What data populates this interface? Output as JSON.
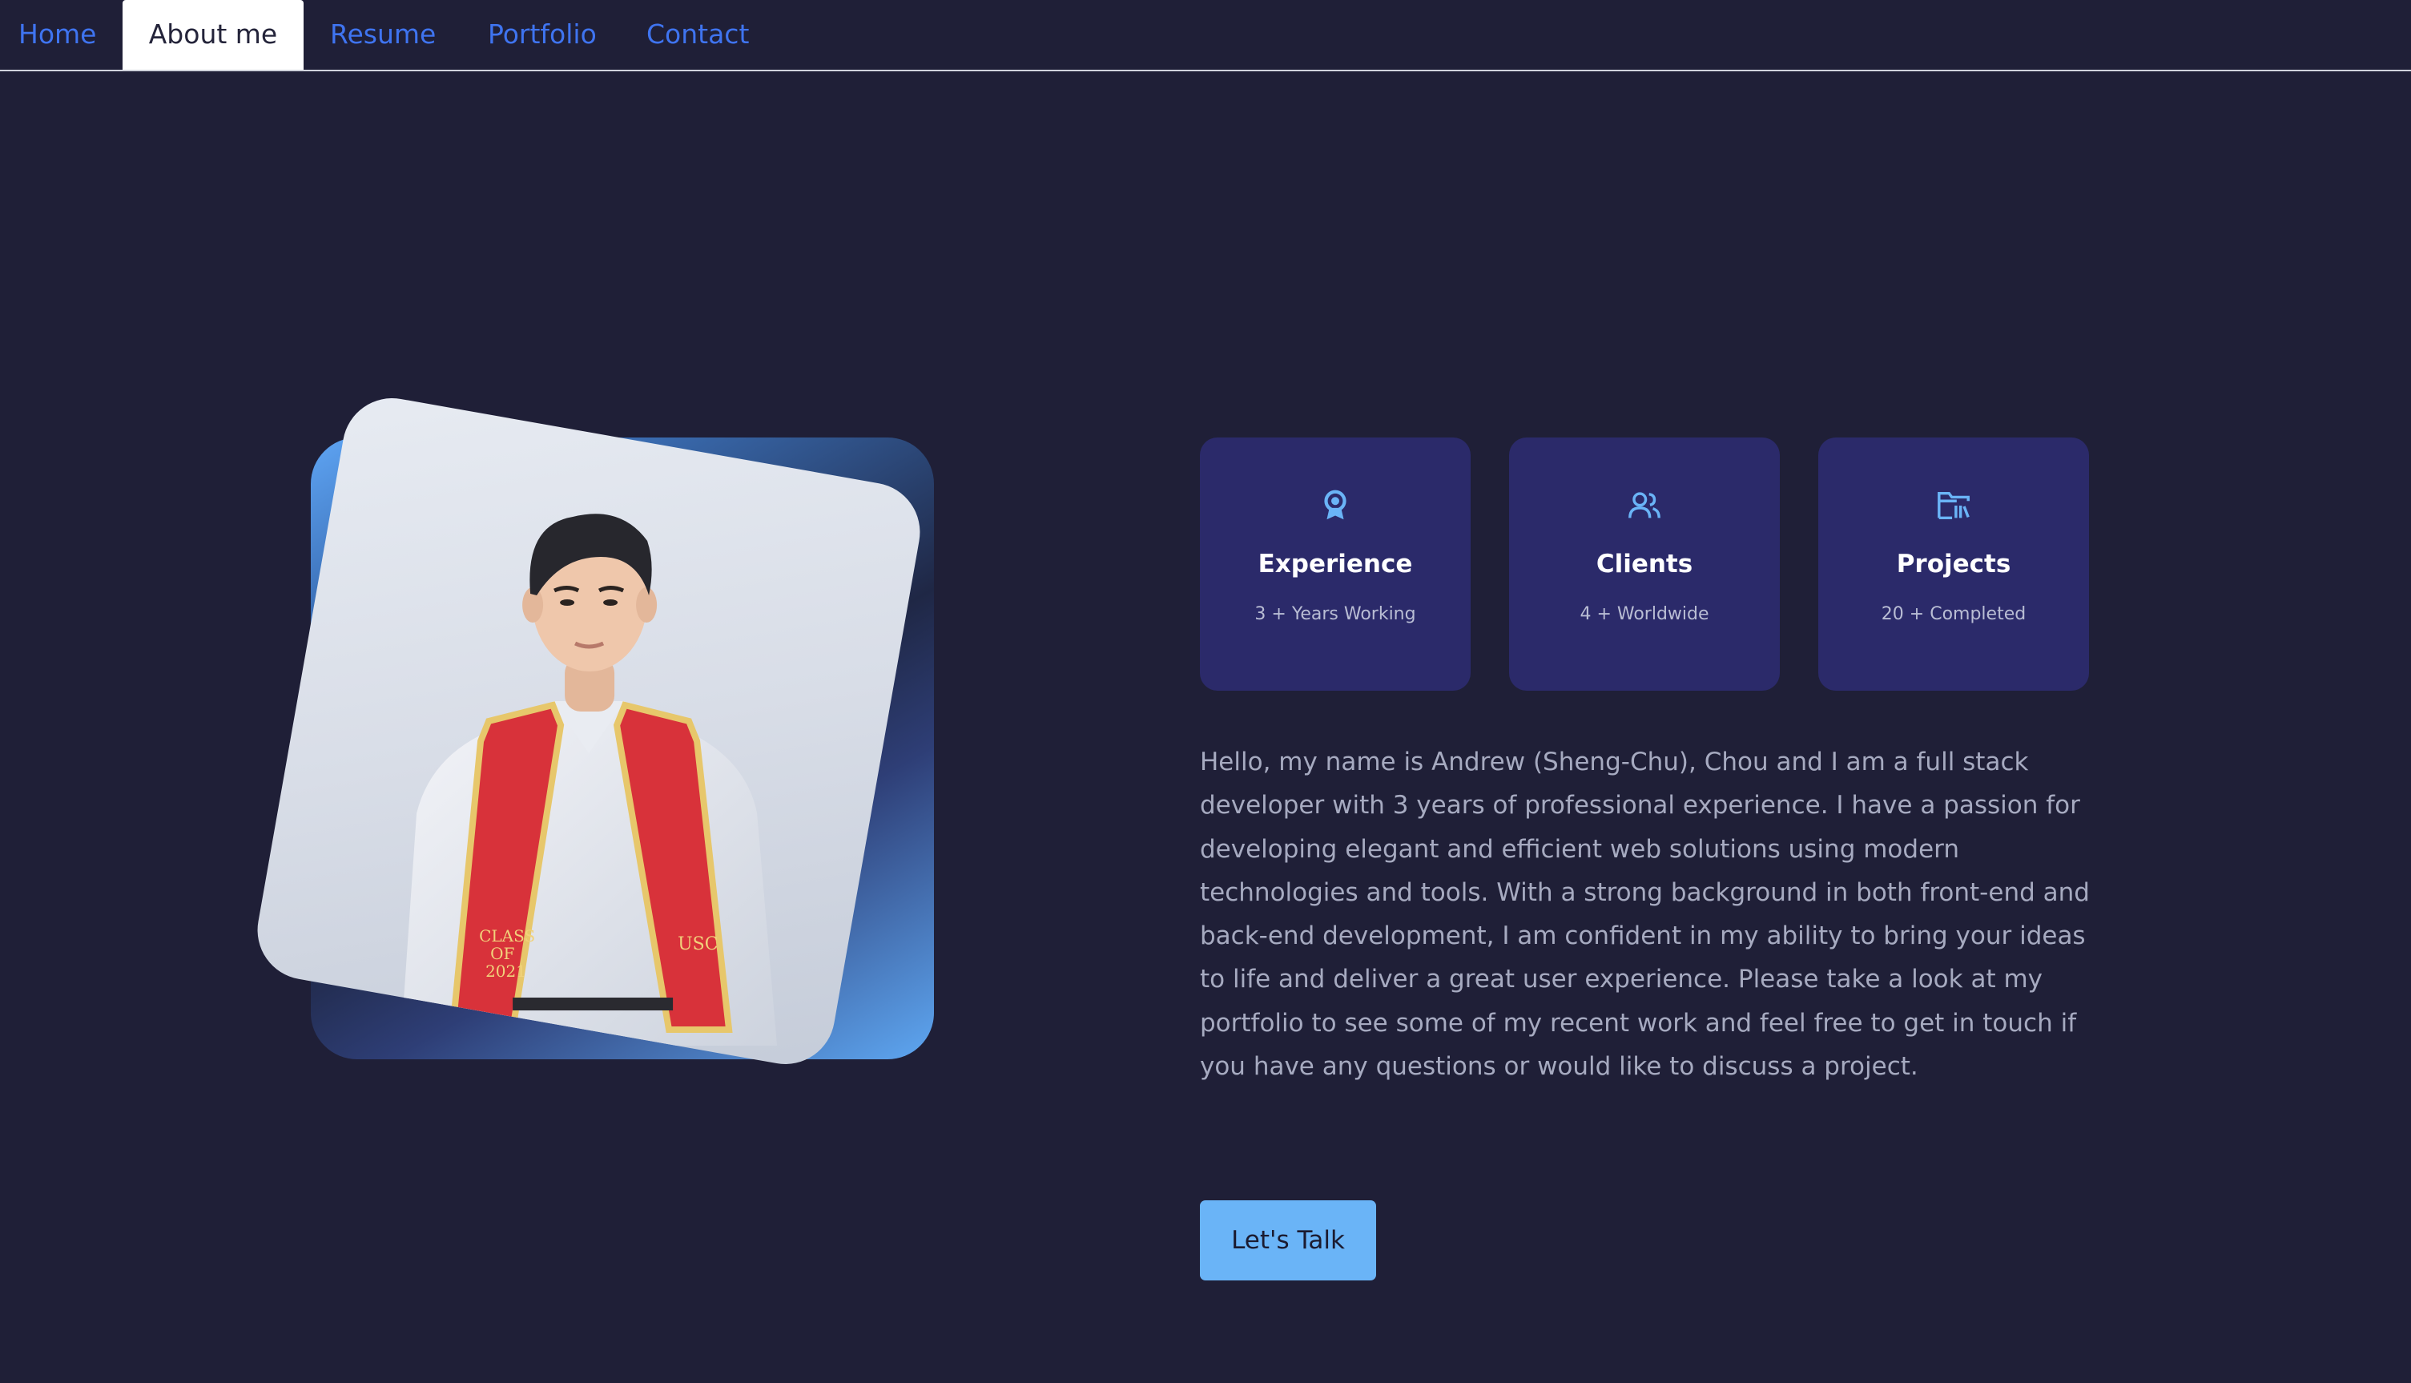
{
  "nav": {
    "items": [
      {
        "label": "Home"
      },
      {
        "label": "About me",
        "active": true
      },
      {
        "label": "Resume"
      },
      {
        "label": "Portfolio"
      },
      {
        "label": "Contact"
      }
    ]
  },
  "photo": {
    "sash_left_text": "CLASS OF 2021",
    "sash_right_text": "USC"
  },
  "stats": [
    {
      "icon": "award-icon",
      "title": "Experience",
      "subtitle": "3 + Years Working"
    },
    {
      "icon": "users-icon",
      "title": "Clients",
      "subtitle": "4 + Worldwide"
    },
    {
      "icon": "folder-icon",
      "title": "Projects",
      "subtitle": "20 + Completed"
    }
  ],
  "bio": {
    "text": "Hello, my name is Andrew (Sheng-Chu), Chou and I am a full stack developer with 3 years of professional experience. I have a passion for developing elegant and efficient web solutions using modern technologies and tools. With a strong background in both front-end and back-end development, I am confident in my ability to bring your ideas to life and deliver a great user experience. Please take a look at my portfolio to see some of my recent work and feel free to get in touch if you have any questions or would like to discuss a project."
  },
  "cta": {
    "label": "Let's Talk"
  },
  "colors": {
    "background": "#1f1f37",
    "nav_link": "#3f74f0",
    "card_bg": "#2b2a6a",
    "icon_blue": "#6ab4f7",
    "sash_red": "#d8323a",
    "sash_gold": "#e7c76b"
  }
}
